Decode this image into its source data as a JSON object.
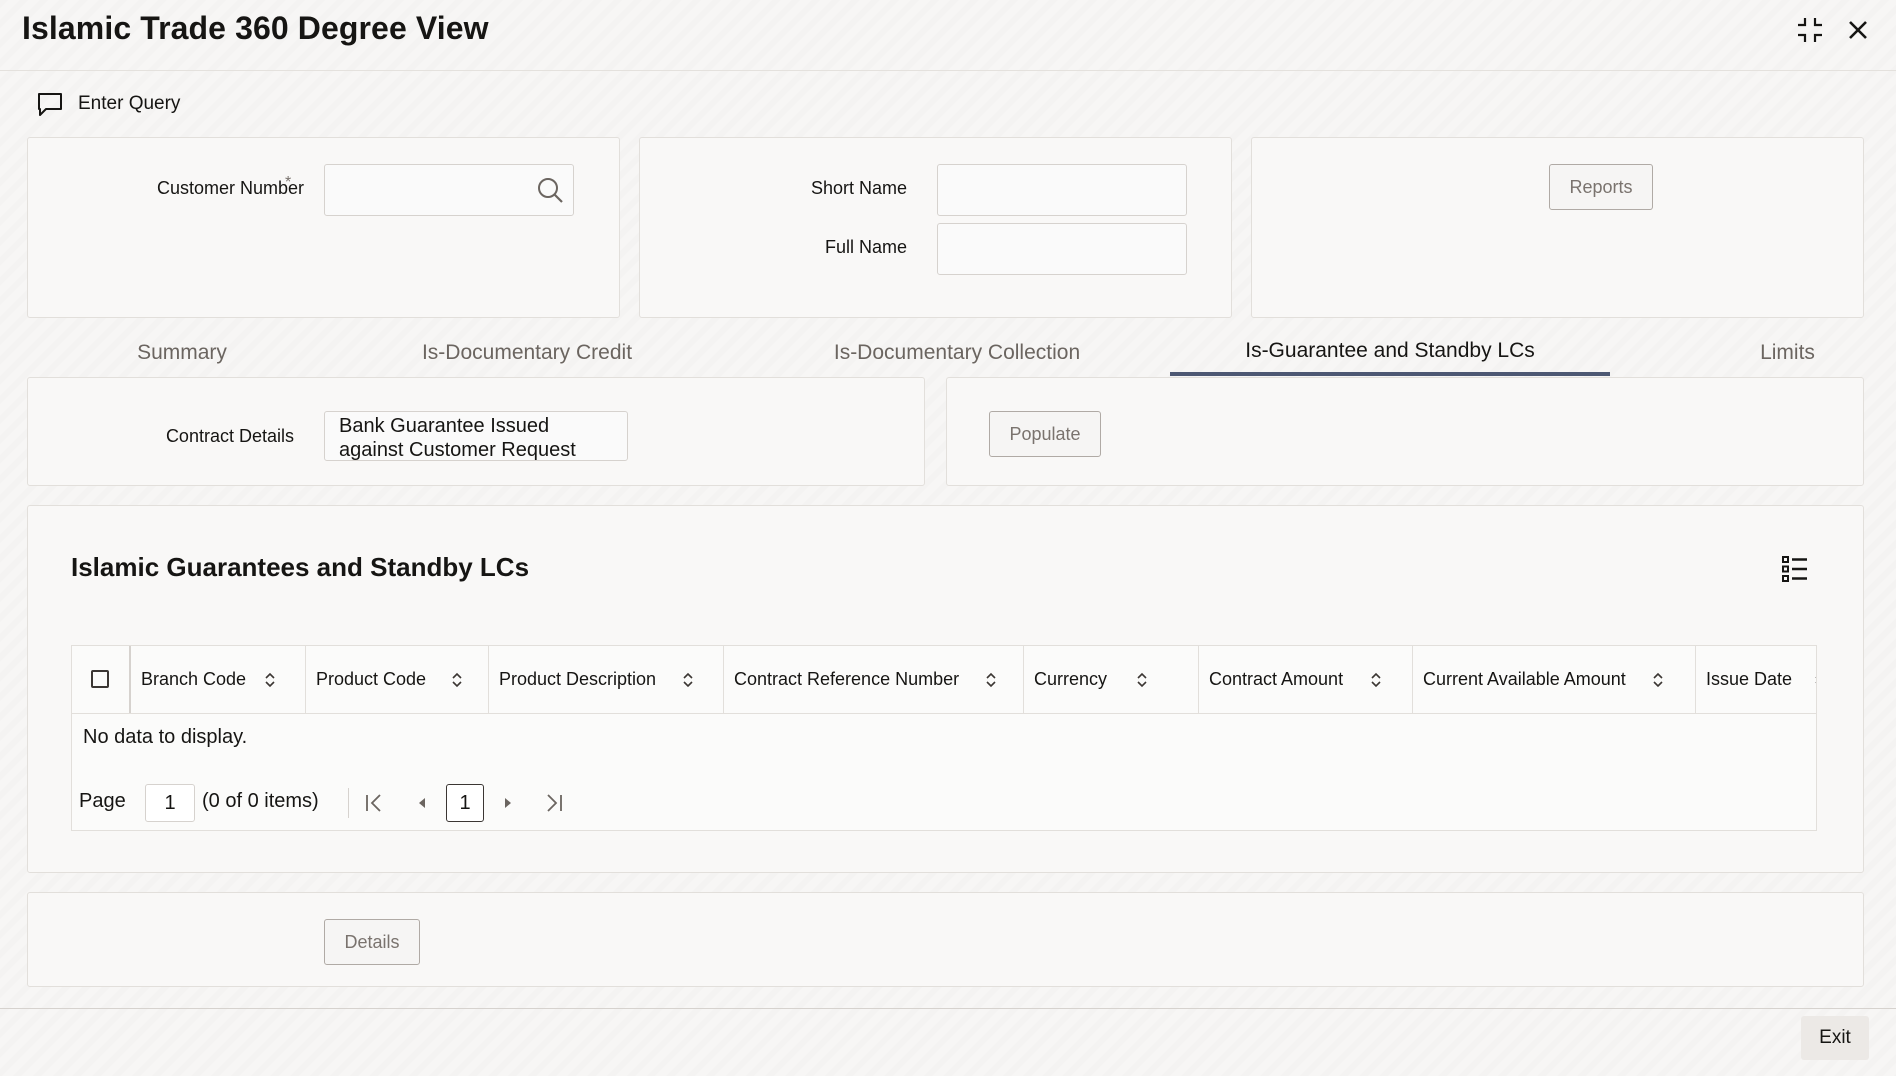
{
  "window": {
    "title": "Islamic Trade 360 Degree View"
  },
  "toolbar": {
    "enter_query_label": "Enter Query"
  },
  "customer": {
    "customer_number_label": "Customer Number",
    "required_mark": "*",
    "customer_number_value": "",
    "short_name_label": "Short Name",
    "short_name_value": "",
    "full_name_label": "Full Name",
    "full_name_value": ""
  },
  "actions": {
    "reports_label": "Reports",
    "populate_label": "Populate",
    "details_label": "Details",
    "exit_label": "Exit"
  },
  "tabs": [
    {
      "label": "Summary",
      "active": false
    },
    {
      "label": "Is-Documentary Credit",
      "active": false
    },
    {
      "label": "Is-Documentary Collection",
      "active": false
    },
    {
      "label": "Is-Guarantee and Standby LCs",
      "active": true
    },
    {
      "label": "Limits",
      "active": false
    }
  ],
  "contract": {
    "label": "Contract Details",
    "value_line1": "Bank Guarantee Issued",
    "value_line2": "against Customer Request"
  },
  "section": {
    "title": "Islamic Guarantees and Standby LCs"
  },
  "grid": {
    "columns": [
      "Branch Code",
      "Product Code",
      "Product Description",
      "Contract Reference Number",
      "Currency",
      "Contract Amount",
      "Current Available Amount",
      "Issue Date"
    ],
    "empty_text": "No data to display.",
    "pager": {
      "page_label": "Page",
      "page_input": "1",
      "items_text": "(0 of 0 items)",
      "current_page": "1"
    }
  },
  "icons": {
    "enter_query": "speech-bubble-icon",
    "search": "search-icon",
    "maximize": "collapse-arrows-icon",
    "close": "close-icon",
    "column_settings": "list-settings-icon"
  }
}
